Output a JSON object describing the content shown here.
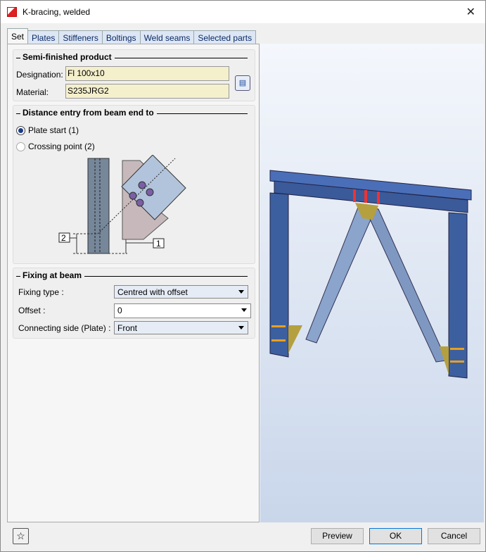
{
  "window": {
    "title": "K-bracing, welded"
  },
  "tabs": [
    "Set",
    "Plates",
    "Stiffeners",
    "Boltings",
    "Weld seams",
    "Selected parts"
  ],
  "semi": {
    "heading": "Semi-finished product",
    "designation_label": "Designation:",
    "designation": "Fl 100x10",
    "material_label": "Material:",
    "material": "S235JRG2"
  },
  "distance": {
    "heading": "Distance entry from beam end to",
    "opt1": "Plate start (1)",
    "opt2": "Crossing point (2)",
    "label1": "1",
    "label2": "2"
  },
  "fixing": {
    "heading": "Fixing at beam",
    "type_label": "Fixing type :",
    "type": "Centred with offset",
    "offset_label": "Offset :",
    "offset": "0",
    "side_label": "Connecting side (Plate) :",
    "side": "Front"
  },
  "buttons": {
    "preview": "Preview",
    "ok": "OK",
    "cancel": "Cancel"
  }
}
